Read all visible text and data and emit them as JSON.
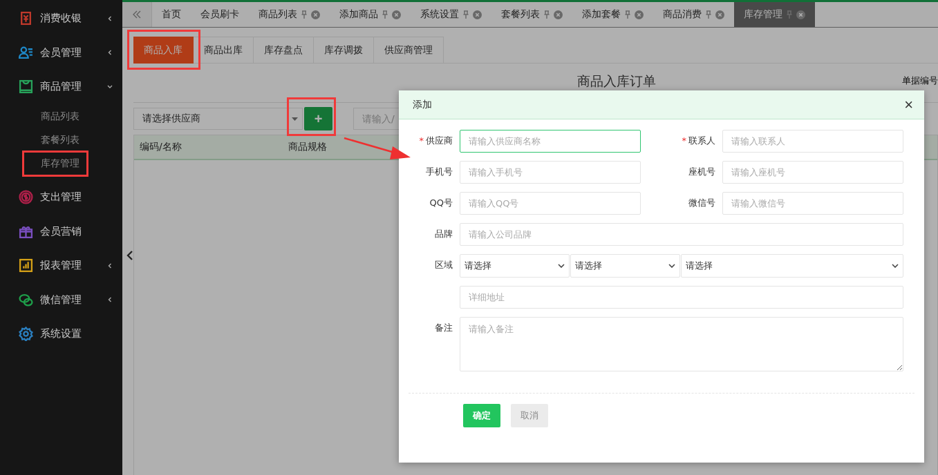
{
  "sidebar": {
    "items": [
      {
        "label": "消费收银",
        "color": "#c0392b",
        "has_submenu": true,
        "expanded": false
      },
      {
        "label": "会员管理",
        "color": "#1e88c7",
        "has_submenu": true,
        "expanded": false
      },
      {
        "label": "商品管理",
        "color": "#27a25a",
        "has_submenu": true,
        "expanded": true,
        "children": [
          {
            "label": "商品列表",
            "selected": false,
            "highlighted": false
          },
          {
            "label": "套餐列表",
            "selected": false,
            "highlighted": false
          },
          {
            "label": "库存管理",
            "selected": false,
            "highlighted": true
          }
        ]
      },
      {
        "label": "支出管理",
        "color": "#b0204a"
      },
      {
        "label": "会员营销",
        "color": "#7a4fc0"
      },
      {
        "label": "报表管理",
        "color": "#d4a017",
        "has_submenu": true,
        "expanded": false
      },
      {
        "label": "微信管理",
        "color": "#1e9e4a",
        "has_submenu": true,
        "expanded": false
      },
      {
        "label": "系统设置",
        "color": "#2a7fc0"
      }
    ]
  },
  "tabs": [
    {
      "label": "首页",
      "closable": false,
      "selected": false
    },
    {
      "label": "会员刷卡",
      "closable": false,
      "selected": false
    },
    {
      "label": "商品列表",
      "closable": true,
      "selected": false
    },
    {
      "label": "添加商品",
      "closable": true,
      "selected": false
    },
    {
      "label": "系统设置",
      "closable": true,
      "selected": false
    },
    {
      "label": "套餐列表",
      "closable": true,
      "selected": false
    },
    {
      "label": "添加套餐",
      "closable": true,
      "selected": false
    },
    {
      "label": "商品消费",
      "closable": true,
      "selected": false
    },
    {
      "label": "库存管理",
      "closable": true,
      "selected": true
    }
  ],
  "sub_tabs": [
    {
      "label": "商品入库",
      "selected": true,
      "highlighted": true
    },
    {
      "label": "商品出库",
      "selected": false,
      "highlighted": false
    },
    {
      "label": "库存盘点",
      "selected": false,
      "highlighted": false
    },
    {
      "label": "库存调拨",
      "selected": false,
      "highlighted": false
    },
    {
      "label": "供应商管理",
      "selected": false,
      "highlighted": false
    }
  ],
  "page_title": "商品入库订单",
  "order_number_label": "单据编号",
  "supplier_select": {
    "value": "请选择供应商"
  },
  "add_button": {
    "label": "+",
    "highlighted": true,
    "arrow_to_dialog": true
  },
  "search": {
    "placeholder": "请输入/"
  },
  "table": {
    "columns": [
      "编码/名称",
      "商品规格"
    ]
  },
  "dialog": {
    "title": "添加",
    "close": "×",
    "fields": [
      {
        "kind": "half",
        "label": "供应商",
        "required_mark": "*",
        "placeholder": "请输入供应商名称",
        "focused": true
      },
      {
        "kind": "half",
        "label": "联系人",
        "required_mark": "*",
        "placeholder": "请输入联系人",
        "focused": false
      },
      {
        "kind": "half",
        "label": "手机号",
        "placeholder": "请输入手机号",
        "focused": false
      },
      {
        "kind": "half",
        "label": "座机号",
        "placeholder": "请输入座机号",
        "focused": false
      },
      {
        "kind": "half",
        "label": "QQ号",
        "placeholder": "请输入QQ号",
        "focused": false
      },
      {
        "kind": "half",
        "label": "微信号",
        "placeholder": "请输入微信号",
        "focused": false
      },
      {
        "kind": "full",
        "label": "品牌",
        "placeholder": "请输入公司品牌",
        "focused": false
      },
      {
        "kind": "selects",
        "label": "区域",
        "values": [
          "请选择",
          "请选择",
          "请选择"
        ]
      },
      {
        "kind": "full",
        "placeholder": "详细地址",
        "focused": false
      },
      {
        "kind": "textarea",
        "label": "备注",
        "placeholder": "请输入备注",
        "focused": false
      }
    ],
    "buttons": [
      {
        "label": "确定",
        "kind": "primary"
      },
      {
        "label": "取消",
        "kind": "secondary"
      }
    ]
  }
}
